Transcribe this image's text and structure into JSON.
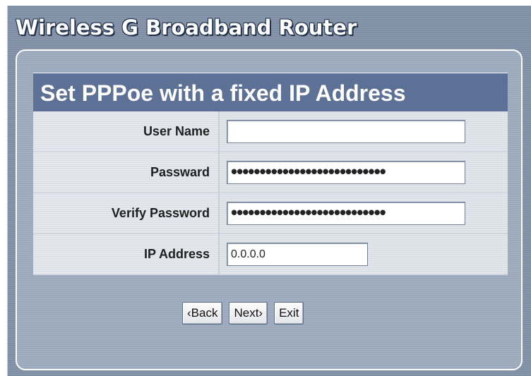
{
  "app": {
    "title": "Wireless G Broadband Router"
  },
  "form": {
    "title": "Set PPPoe with a fixed IP Address",
    "fields": [
      {
        "label": "User Name",
        "value": ""
      },
      {
        "label": "Passward",
        "value": "•••••••••••••••••••••••••••"
      },
      {
        "label": "Verify Password",
        "value": "•••••••••••••••••••••••••••"
      },
      {
        "label": "IP Address",
        "value": "0.0.0.0"
      }
    ]
  },
  "buttons": {
    "back": "‹Back",
    "next": "Next›",
    "exit": "Exit"
  }
}
